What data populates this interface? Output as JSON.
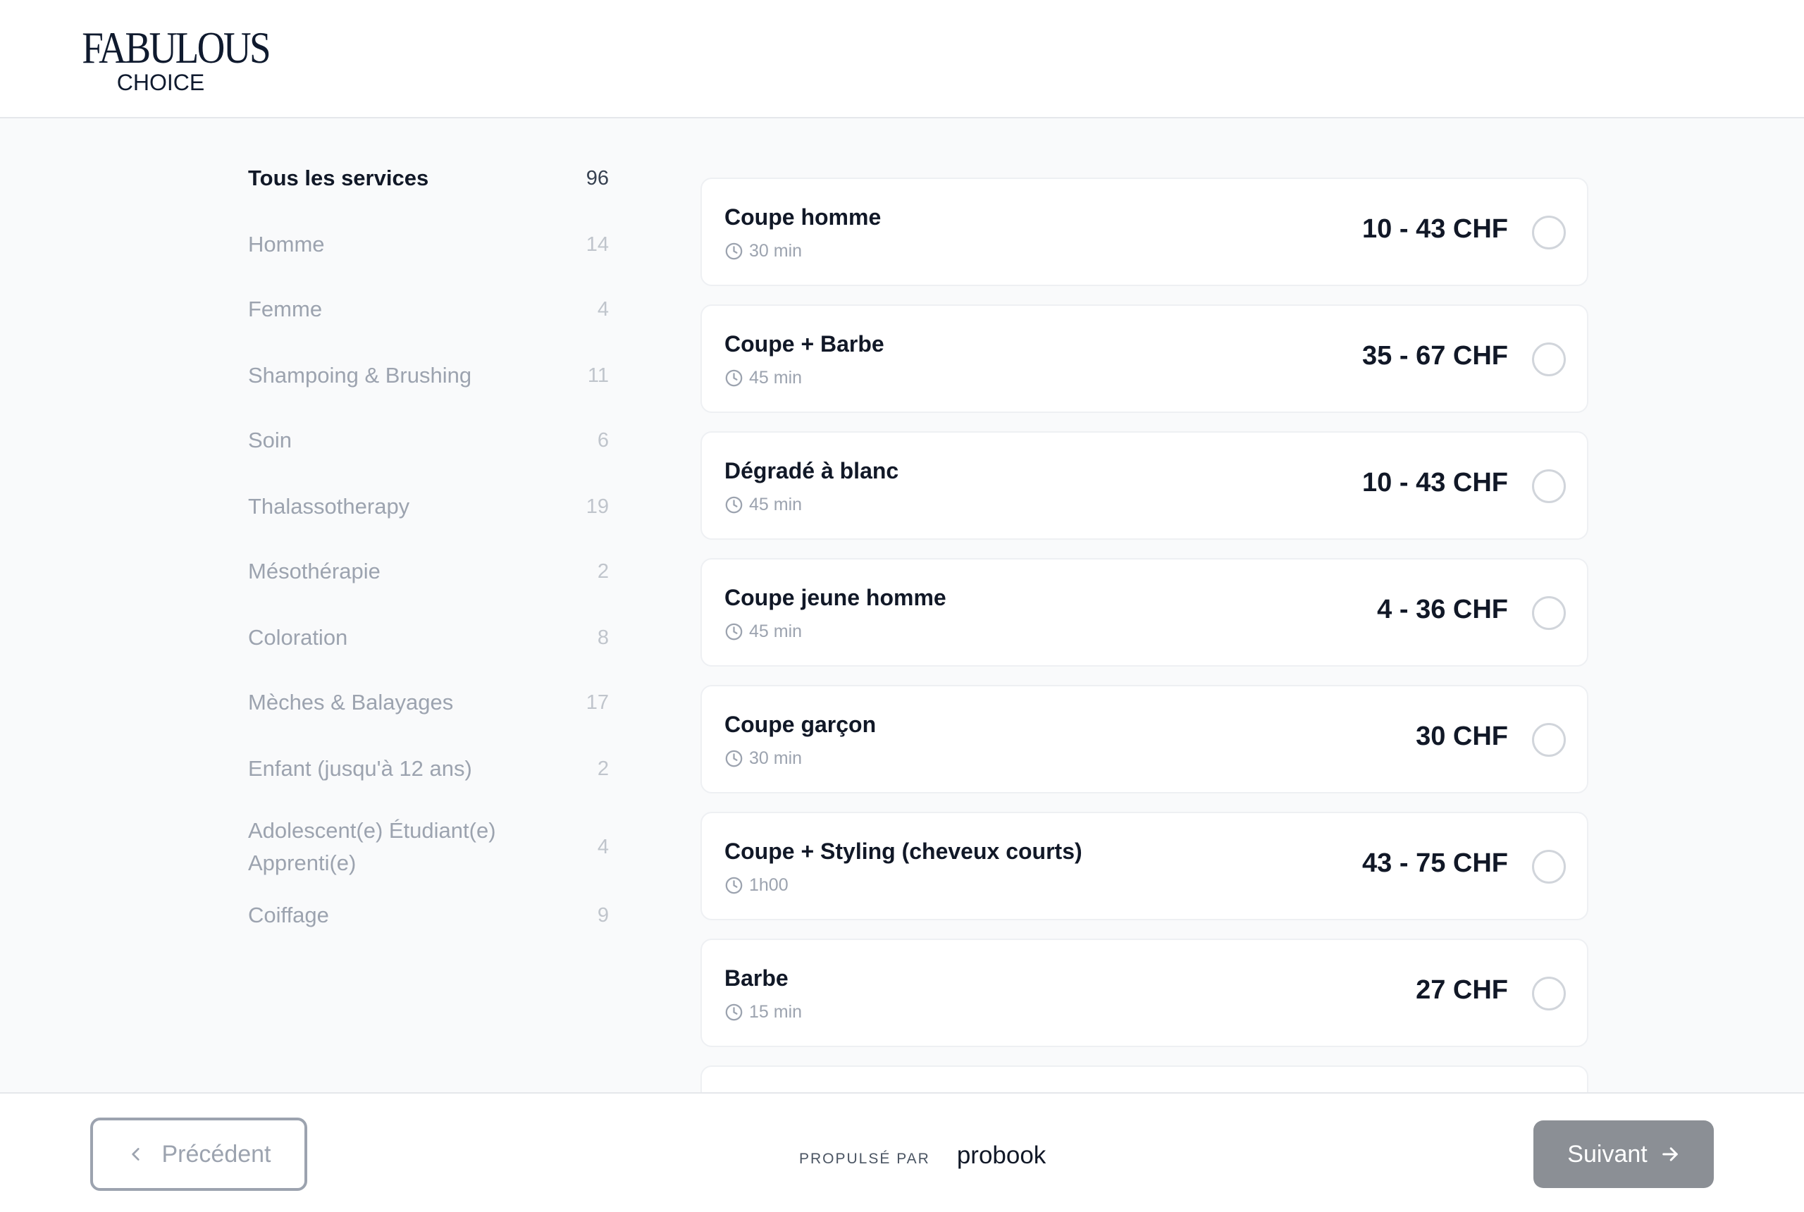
{
  "brand": {
    "logo_main": "FABULOUS",
    "logo_sub": "CHOICE"
  },
  "categories": [
    {
      "name": "Tous les services",
      "count": "96",
      "active": true
    },
    {
      "name": "Homme",
      "count": "14"
    },
    {
      "name": "Femme",
      "count": "4"
    },
    {
      "name": "Shampoing & Brushing",
      "count": "11"
    },
    {
      "name": "Soin",
      "count": "6"
    },
    {
      "name": "Thalassotherapy",
      "count": "19"
    },
    {
      "name": "Mésothérapie",
      "count": "2"
    },
    {
      "name": "Coloration",
      "count": "8"
    },
    {
      "name": "Mèches & Balayages",
      "count": "17"
    },
    {
      "name": "Enfant (jusqu'à 12 ans)",
      "count": "2"
    },
    {
      "name": "Adolescent(e) Étudiant(e) Apprenti(e)",
      "count": "4"
    },
    {
      "name": "Coiffage",
      "count": "9"
    }
  ],
  "services": [
    {
      "name": "Coupe homme",
      "duration": "30 min",
      "price": "10 - 43 CHF",
      "selected": false
    },
    {
      "name": "Coupe + Barbe",
      "duration": "45 min",
      "price": "35 - 67 CHF",
      "selected": false
    },
    {
      "name": "Dégradé à blanc",
      "duration": "45 min",
      "price": "10 - 43 CHF",
      "selected": false
    },
    {
      "name": "Coupe jeune homme",
      "duration": "45 min",
      "price": "4 - 36 CHF",
      "selected": false
    },
    {
      "name": "Coupe garçon",
      "duration": "30 min",
      "price": "30 CHF",
      "selected": false
    },
    {
      "name": "Coupe + Styling (cheveux courts)",
      "duration": "1h00",
      "price": "43 - 75 CHF",
      "selected": false
    },
    {
      "name": "Barbe",
      "duration": "15 min",
      "price": "27 CHF",
      "selected": false
    }
  ],
  "footer": {
    "prev_label": "Précédent",
    "powered_label": "PROPULSÉ PAR",
    "powered_brand": "probook",
    "next_label": "Suivant"
  }
}
